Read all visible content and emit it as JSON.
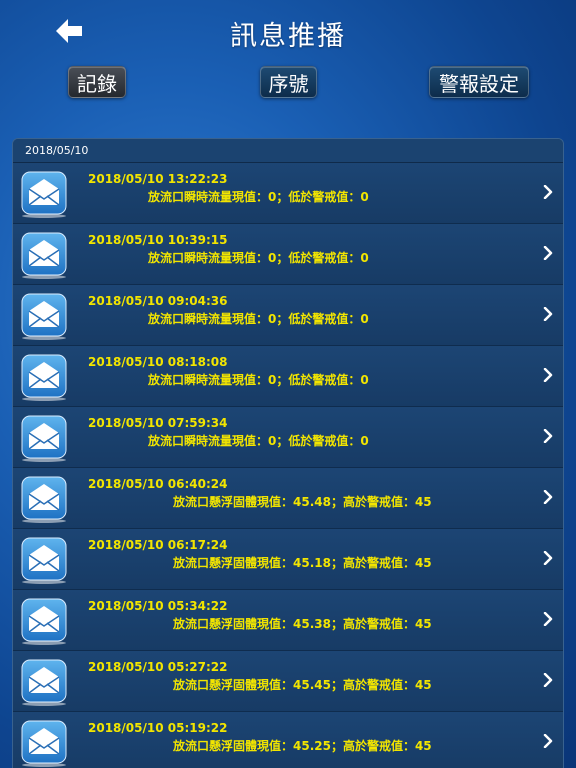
{
  "header": {
    "title": "訊息推播"
  },
  "toolbar": {
    "records_label": "記錄",
    "sequence_label": "序號",
    "alarm_settings_label": "警報設定"
  },
  "list": {
    "date_header": "2018/05/10",
    "items": [
      {
        "time": "2018/05/10 13:22:23",
        "message": "放流口瞬時流量現值：0；低於警戒值：0"
      },
      {
        "time": "2018/05/10 10:39:15",
        "message": "放流口瞬時流量現值：0；低於警戒值：0"
      },
      {
        "time": "2018/05/10 09:04:36",
        "message": "放流口瞬時流量現值：0；低於警戒值：0"
      },
      {
        "time": "2018/05/10 08:18:08",
        "message": "放流口瞬時流量現值：0；低於警戒值：0"
      },
      {
        "time": "2018/05/10 07:59:34",
        "message": "放流口瞬時流量現值：0；低於警戒值：0"
      },
      {
        "time": "2018/05/10 06:40:24",
        "message": "放流口懸浮固體現值：45.48；高於警戒值：45"
      },
      {
        "time": "2018/05/10 06:17:24",
        "message": "放流口懸浮固體現值：45.18；高於警戒值：45"
      },
      {
        "time": "2018/05/10 05:34:22",
        "message": "放流口懸浮固體現值：45.38；高於警戒值：45"
      },
      {
        "time": "2018/05/10 05:27:22",
        "message": "放流口懸浮固體現值：45.45；高於警戒值：45"
      },
      {
        "time": "2018/05/10 05:19:22",
        "message": "放流口懸浮固體現值：45.25；高於警戒值：45"
      }
    ]
  },
  "colors": {
    "message_text": "#f2e500",
    "list_background": "#183d66",
    "page_background": "#1a5fb4"
  },
  "icons": {
    "back": "arrow-left-icon",
    "row": "envelope-icon",
    "row_action": "chevron-right-icon"
  }
}
